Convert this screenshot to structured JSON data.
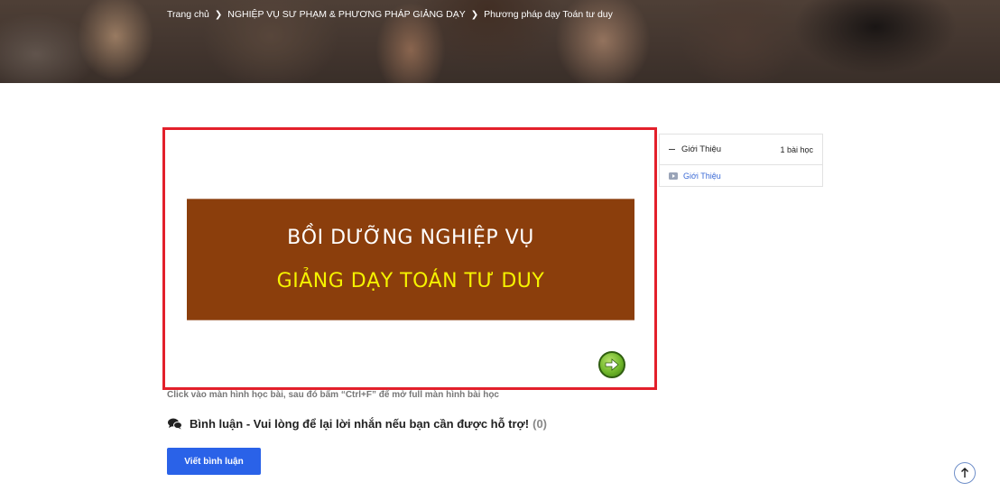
{
  "breadcrumb": {
    "items": [
      "Trang chủ",
      "NGHIỆP VỤ SƯ PHẠM & PHƯƠNG PHÁP GIẢNG DẠY",
      "Phương pháp dạy Toán tư duy"
    ]
  },
  "player": {
    "slide_line1": "BỒI DƯỠNG NGHIỆP VỤ",
    "slide_line2": "GIẢNG DẠY TOÁN TƯ DUY",
    "hint": "Click vào màn hình học bài, sau đó bấm “Ctrl+F” để mở full màn hình bài học"
  },
  "comments": {
    "title": "Bình luận - Vui lòng để lại lời nhắn nếu bạn cần được hỗ trợ!",
    "count": "(0)",
    "write_label": "Viết bình luận"
  },
  "curriculum": {
    "section_title": "Giới Thiệu",
    "section_meta": "1 bài học",
    "lesson_title": "Giới Thiệu"
  },
  "colors": {
    "accent_blue": "#2a62e8",
    "frame_red": "#e3202b",
    "slide_brown": "#8b3e0c",
    "slide_yellow": "#f5f200"
  },
  "icons": {
    "breadcrumb_separator": "chevron-right-icon",
    "next": "arrow-right-circle-icon",
    "comment": "chat-bubbles-icon",
    "lesson": "video-play-icon",
    "scroll_top": "arrow-up-icon"
  }
}
